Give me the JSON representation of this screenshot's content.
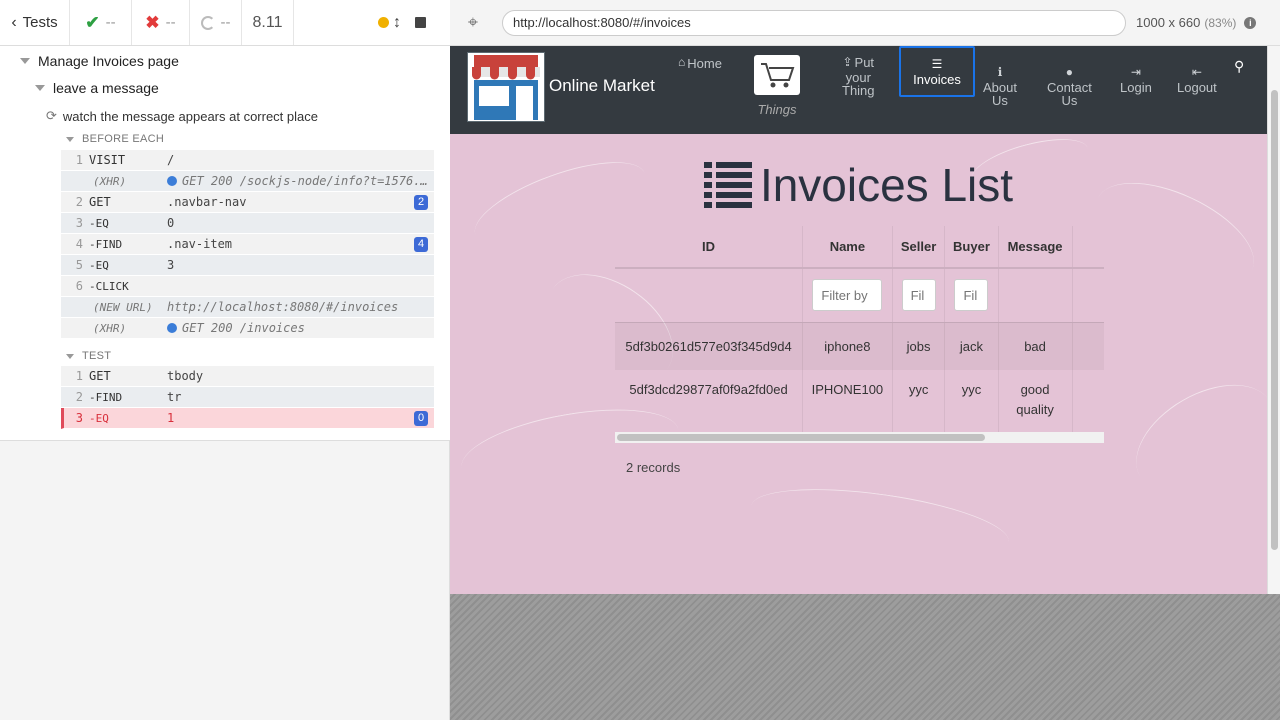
{
  "reporter": {
    "tests_label": "Tests",
    "passed": "--",
    "failed": "--",
    "pending": "--",
    "duration": "8.11",
    "suite": "Manage Invoices page",
    "sub_suite": "leave a message",
    "test": "watch the message appears at correct place",
    "before_each_label": "BEFORE EACH",
    "test_label": "TEST",
    "before_each": [
      {
        "num": "1",
        "name": "VISIT",
        "msg": "/",
        "badge": ""
      },
      {
        "num": "",
        "name": "(XHR)",
        "msg": "GET 200 /sockjs-node/info?t=1576...",
        "xhr": true
      },
      {
        "num": "2",
        "name": "GET",
        "msg": ".navbar-nav",
        "badge": "2"
      },
      {
        "num": "3",
        "name": "-EQ",
        "msg": "0",
        "badge": ""
      },
      {
        "num": "4",
        "name": "-FIND",
        "msg": ".nav-item",
        "badge": "4"
      },
      {
        "num": "5",
        "name": "-EQ",
        "msg": "3",
        "badge": ""
      },
      {
        "num": "6",
        "name": "-CLICK",
        "msg": "",
        "badge": ""
      },
      {
        "num": "",
        "name": "(NEW URL)",
        "msg": "http://localhost:8080/#/invoices"
      },
      {
        "num": "",
        "name": "(XHR)",
        "msg": "GET 200 /invoices",
        "xhr": true
      }
    ],
    "test_cmds": [
      {
        "num": "1",
        "name": "GET",
        "msg": "tbody",
        "badge": ""
      },
      {
        "num": "2",
        "name": "-FIND",
        "msg": "tr",
        "badge": ""
      },
      {
        "num": "3",
        "name": "-EQ",
        "msg": "1",
        "badge": "0"
      }
    ]
  },
  "aut": {
    "url": "http://localhost:8080/#/invoices",
    "viewport": "1000 x 660",
    "scale": "(83%)"
  },
  "app": {
    "brand": "Online Market",
    "nav": {
      "home": "Home",
      "things": "Things",
      "put": [
        "Put",
        "your",
        "Thing"
      ],
      "invoices": "Invoices",
      "about": [
        "About",
        "Us"
      ],
      "contact": [
        "Contact",
        "Us"
      ],
      "login": "Login",
      "logout": "Logout"
    },
    "title": "Invoices List",
    "columns": [
      "ID",
      "Name",
      "Seller",
      "Buyer",
      "Message"
    ],
    "filter_placeholders": [
      "Filter by",
      "Fil",
      "Fil"
    ],
    "rows": [
      [
        "5df3b0261d577e03f345d9d4",
        "iphone8",
        "jobs",
        "jack",
        "bad"
      ],
      [
        "5df3dcd29877af0f9a2fd0ed",
        "IPHONE100",
        "yyc",
        "yyc",
        "good quality"
      ]
    ],
    "records": "2 records"
  }
}
